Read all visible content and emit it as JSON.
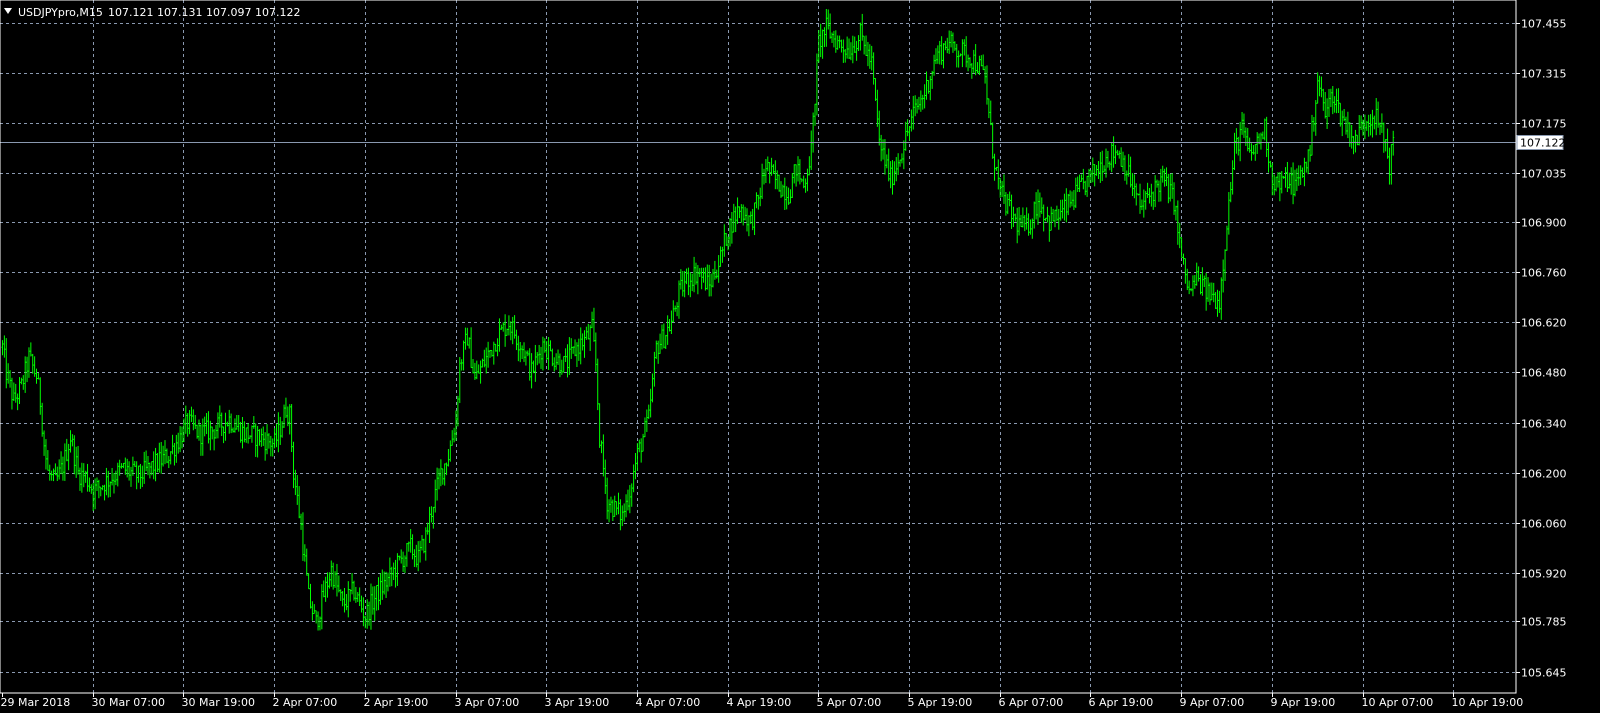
{
  "chart_data": {
    "type": "ohlc",
    "symbol": "USDJPYpro,M15",
    "current_ohlc": {
      "open": "107.121",
      "high": "107.131",
      "low": "107.097",
      "close": "107.122"
    },
    "current_price": 107.122,
    "current_price_label": "107.122",
    "ylim": [
      105.605,
      107.505
    ],
    "y_ticks": [
      {
        "value": 107.455,
        "label": "107.455"
      },
      {
        "value": 107.315,
        "label": "107.315"
      },
      {
        "value": 107.175,
        "label": "107.175"
      },
      {
        "value": 107.035,
        "label": "107.035"
      },
      {
        "value": 106.9,
        "label": "106.900"
      },
      {
        "value": 106.76,
        "label": "106.760"
      },
      {
        "value": 106.62,
        "label": "106.620"
      },
      {
        "value": 106.48,
        "label": "106.480"
      },
      {
        "value": 106.34,
        "label": "106.340"
      },
      {
        "value": 106.2,
        "label": "106.200"
      },
      {
        "value": 106.06,
        "label": "106.060"
      },
      {
        "value": 105.92,
        "label": "105.920"
      },
      {
        "value": 105.785,
        "label": "105.785"
      },
      {
        "value": 105.645,
        "label": "105.645"
      }
    ],
    "x_ticks": [
      "29 Mar 2018",
      "30 Mar 07:00",
      "30 Mar 19:00",
      "2 Apr 07:00",
      "2 Apr 19:00",
      "3 Apr 07:00",
      "3 Apr 19:00",
      "4 Apr 07:00",
      "4 Apr 19:00",
      "5 Apr 07:00",
      "5 Apr 19:00",
      "6 Apr 07:00",
      "6 Apr 19:00",
      "9 Apr 07:00",
      "9 Apr 19:00",
      "10 Apr 07:00",
      "10 Apr 19:00"
    ],
    "bars_per_tick": 48,
    "bar_color": "#00ff00",
    "grid": true,
    "grid_color": "#8a99b0",
    "price_line_color": "#8a99b0",
    "path_close": [
      [
        0,
        106.55
      ],
      [
        2,
        106.48
      ],
      [
        6,
        106.4
      ],
      [
        10,
        106.44
      ],
      [
        14,
        106.52
      ],
      [
        18,
        106.47
      ],
      [
        20,
        106.4
      ],
      [
        22,
        106.28
      ],
      [
        24,
        106.2
      ],
      [
        28,
        106.17
      ],
      [
        32,
        106.22
      ],
      [
        36,
        106.3
      ],
      [
        40,
        106.2
      ],
      [
        44,
        106.19
      ],
      [
        48,
        106.15
      ],
      [
        56,
        106.18
      ],
      [
        64,
        106.21
      ],
      [
        72,
        106.19
      ],
      [
        80,
        106.22
      ],
      [
        88,
        106.25
      ],
      [
        94,
        106.3
      ],
      [
        98,
        106.34
      ],
      [
        104,
        106.31
      ],
      [
        112,
        106.32
      ],
      [
        120,
        106.35
      ],
      [
        128,
        106.31
      ],
      [
        136,
        106.3
      ],
      [
        144,
        106.28
      ],
      [
        148,
        106.34
      ],
      [
        150,
        106.38
      ],
      [
        152,
        106.36
      ],
      [
        154,
        106.2
      ],
      [
        158,
        106.05
      ],
      [
        162,
        105.85
      ],
      [
        166,
        105.78
      ],
      [
        170,
        105.86
      ],
      [
        174,
        105.93
      ],
      [
        180,
        105.83
      ],
      [
        186,
        105.87
      ],
      [
        192,
        105.8
      ],
      [
        198,
        105.86
      ],
      [
        204,
        105.9
      ],
      [
        210,
        105.95
      ],
      [
        216,
        105.99
      ],
      [
        220,
        105.96
      ],
      [
        224,
        106.02
      ],
      [
        228,
        106.12
      ],
      [
        232,
        106.2
      ],
      [
        236,
        106.25
      ],
      [
        240,
        106.35
      ],
      [
        242,
        106.5
      ],
      [
        246,
        106.58
      ],
      [
        250,
        106.46
      ],
      [
        256,
        106.52
      ],
      [
        262,
        106.58
      ],
      [
        268,
        106.62
      ],
      [
        272,
        106.58
      ],
      [
        276,
        106.54
      ],
      [
        280,
        106.48
      ],
      [
        286,
        106.56
      ],
      [
        292,
        106.52
      ],
      [
        298,
        106.5
      ],
      [
        304,
        106.55
      ],
      [
        310,
        106.58
      ],
      [
        312,
        106.6
      ],
      [
        314,
        106.5
      ],
      [
        316,
        106.3
      ],
      [
        320,
        106.12
      ],
      [
        324,
        106.1
      ],
      [
        328,
        106.08
      ],
      [
        332,
        106.15
      ],
      [
        336,
        106.25
      ],
      [
        342,
        106.35
      ],
      [
        346,
        106.55
      ],
      [
        350,
        106.58
      ],
      [
        354,
        106.62
      ],
      [
        358,
        106.7
      ],
      [
        362,
        106.74
      ],
      [
        368,
        106.76
      ],
      [
        374,
        106.72
      ],
      [
        380,
        106.8
      ],
      [
        384,
        106.88
      ],
      [
        390,
        106.94
      ],
      [
        396,
        106.9
      ],
      [
        400,
        106.96
      ],
      [
        404,
        107.06
      ],
      [
        408,
        107.02
      ],
      [
        412,
        107.0
      ],
      [
        416,
        106.98
      ],
      [
        420,
        107.05
      ],
      [
        424,
        107.0
      ],
      [
        428,
        107.1
      ],
      [
        432,
        107.4
      ],
      [
        436,
        107.44
      ],
      [
        442,
        107.4
      ],
      [
        448,
        107.38
      ],
      [
        454,
        107.42
      ],
      [
        460,
        107.34
      ],
      [
        464,
        107.12
      ],
      [
        470,
        107.02
      ],
      [
        476,
        107.1
      ],
      [
        482,
        107.2
      ],
      [
        488,
        107.26
      ],
      [
        494,
        107.36
      ],
      [
        500,
        107.4
      ],
      [
        506,
        107.38
      ],
      [
        512,
        107.36
      ],
      [
        516,
        107.34
      ],
      [
        520,
        107.3
      ],
      [
        524,
        107.1
      ],
      [
        528,
        106.98
      ],
      [
        532,
        106.94
      ],
      [
        536,
        106.9
      ],
      [
        542,
        106.88
      ],
      [
        548,
        106.96
      ],
      [
        554,
        106.9
      ],
      [
        560,
        106.92
      ],
      [
        566,
        106.96
      ],
      [
        572,
        107.0
      ],
      [
        578,
        107.04
      ],
      [
        584,
        107.08
      ],
      [
        590,
        107.1
      ],
      [
        594,
        107.06
      ],
      [
        598,
        107.0
      ],
      [
        602,
        106.94
      ],
      [
        608,
        106.98
      ],
      [
        614,
        107.02
      ],
      [
        620,
        106.96
      ],
      [
        624,
        106.8
      ],
      [
        628,
        106.7
      ],
      [
        632,
        106.74
      ],
      [
        638,
        106.7
      ],
      [
        644,
        106.68
      ],
      [
        648,
        106.9
      ],
      [
        652,
        107.1
      ],
      [
        656,
        107.16
      ],
      [
        660,
        107.08
      ],
      [
        664,
        107.12
      ],
      [
        668,
        107.16
      ],
      [
        672,
        107.02
      ],
      [
        676,
        107.0
      ],
      [
        680,
        107.02
      ],
      [
        684,
        107.0
      ],
      [
        688,
        107.04
      ],
      [
        692,
        107.1
      ],
      [
        696,
        107.3
      ],
      [
        700,
        107.2
      ],
      [
        704,
        107.26
      ],
      [
        708,
        107.2
      ],
      [
        712,
        107.16
      ],
      [
        716,
        107.12
      ],
      [
        720,
        107.18
      ],
      [
        726,
        107.2
      ],
      [
        732,
        107.12
      ],
      [
        734,
        107.06
      ],
      [
        736,
        107.12
      ]
    ]
  }
}
